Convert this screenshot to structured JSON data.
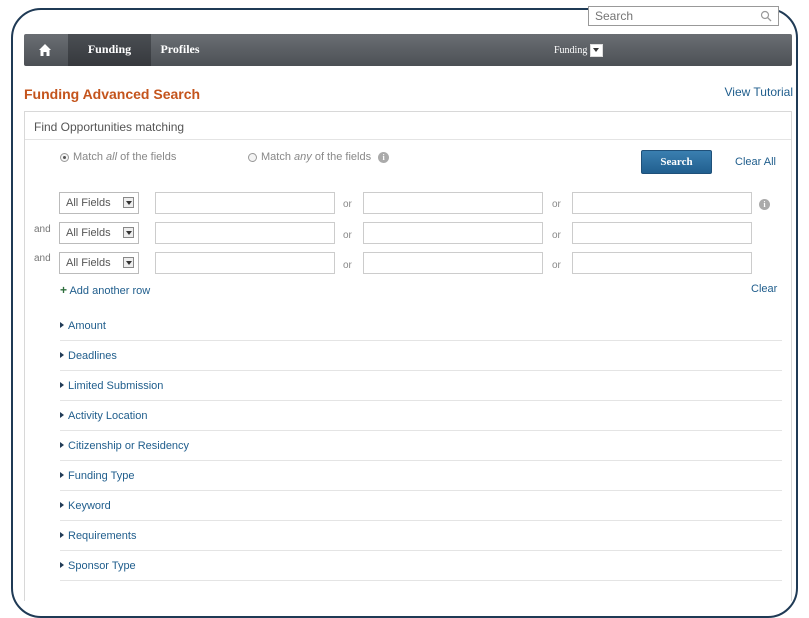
{
  "nav": {
    "tabs": [
      {
        "label": "Funding"
      },
      {
        "label": "Profiles"
      }
    ],
    "scope_select": "Funding",
    "search_placeholder": "Search"
  },
  "page": {
    "title": "Funding Advanced Search",
    "view_tutorial": "View Tutorial",
    "panel_heading": "Find Opportunities matching"
  },
  "match": {
    "all_prefix": "Match ",
    "all_em": "all",
    "all_suffix": " of the fields",
    "any_prefix": "Match ",
    "any_em": "any",
    "any_suffix": " of the fields",
    "search_button": "Search",
    "clear_all": "Clear All"
  },
  "rows": {
    "connector": "and",
    "field_value": "All Fields",
    "or_label": "or",
    "add_row": "Add another row",
    "clear": "Clear"
  },
  "filters": [
    {
      "label": "Amount"
    },
    {
      "label": "Deadlines"
    },
    {
      "label": "Limited Submission"
    },
    {
      "label": "Activity Location"
    },
    {
      "label": "Citizenship or Residency"
    },
    {
      "label": "Funding Type"
    },
    {
      "label": "Keyword"
    },
    {
      "label": "Requirements"
    },
    {
      "label": "Sponsor Type"
    }
  ],
  "colors": {
    "title": "#c4541c",
    "link": "#1f5d8c",
    "nav": "#55595e",
    "button": "#2a6c9d"
  }
}
